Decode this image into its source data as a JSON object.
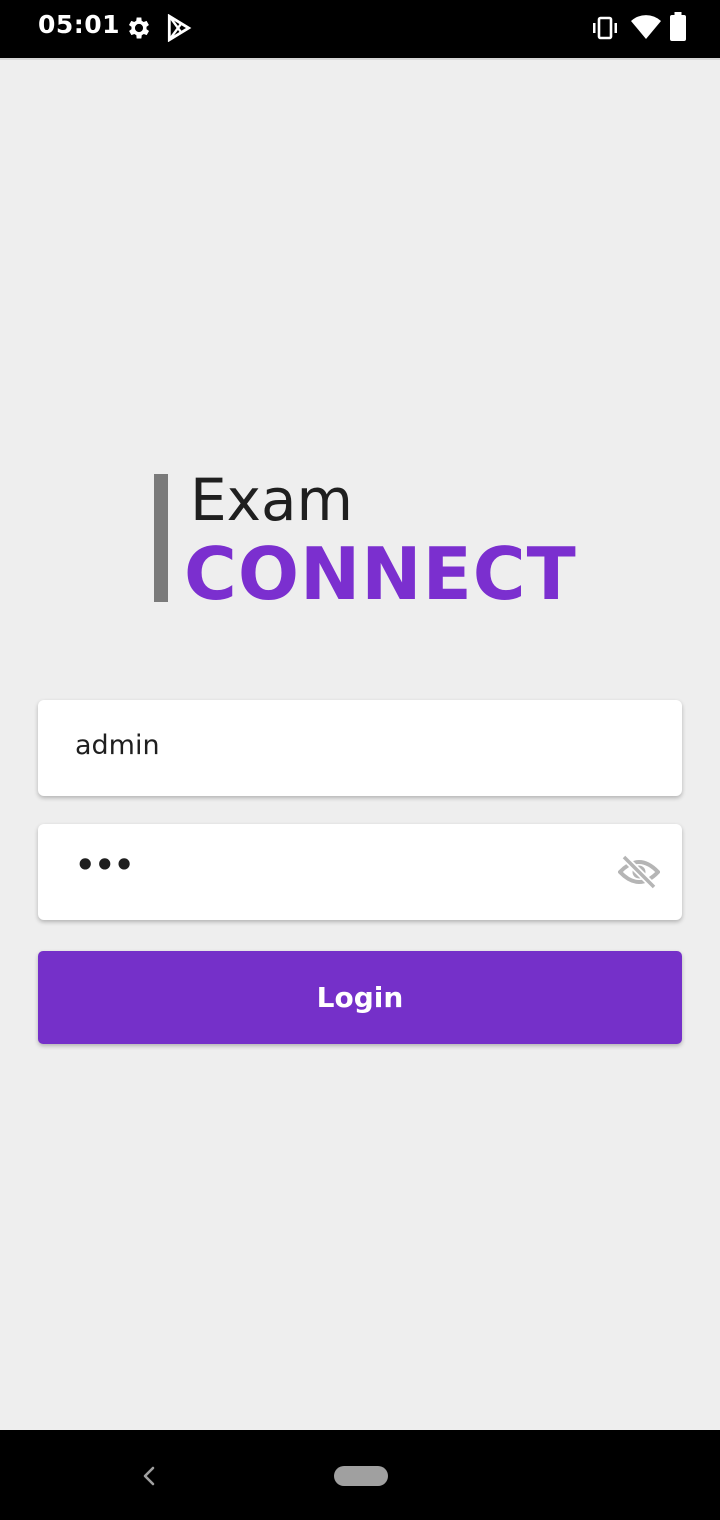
{
  "status_bar": {
    "time": "05:01",
    "icons": [
      "gear-icon",
      "play-store-icon",
      "vibrate-icon",
      "wifi-icon",
      "battery-icon"
    ]
  },
  "logo": {
    "line1": "Exam",
    "line2": "CONNECT",
    "brand_color": "#7b2fcf"
  },
  "form": {
    "username": {
      "value": "admin"
    },
    "password": {
      "masked_value": "•••",
      "toggle_icon": "eye-off-icon"
    },
    "login_label": "Login",
    "accent_color": "#7530c9"
  },
  "nav_bar": {
    "icons": [
      "back-icon",
      "home-pill-icon"
    ]
  }
}
